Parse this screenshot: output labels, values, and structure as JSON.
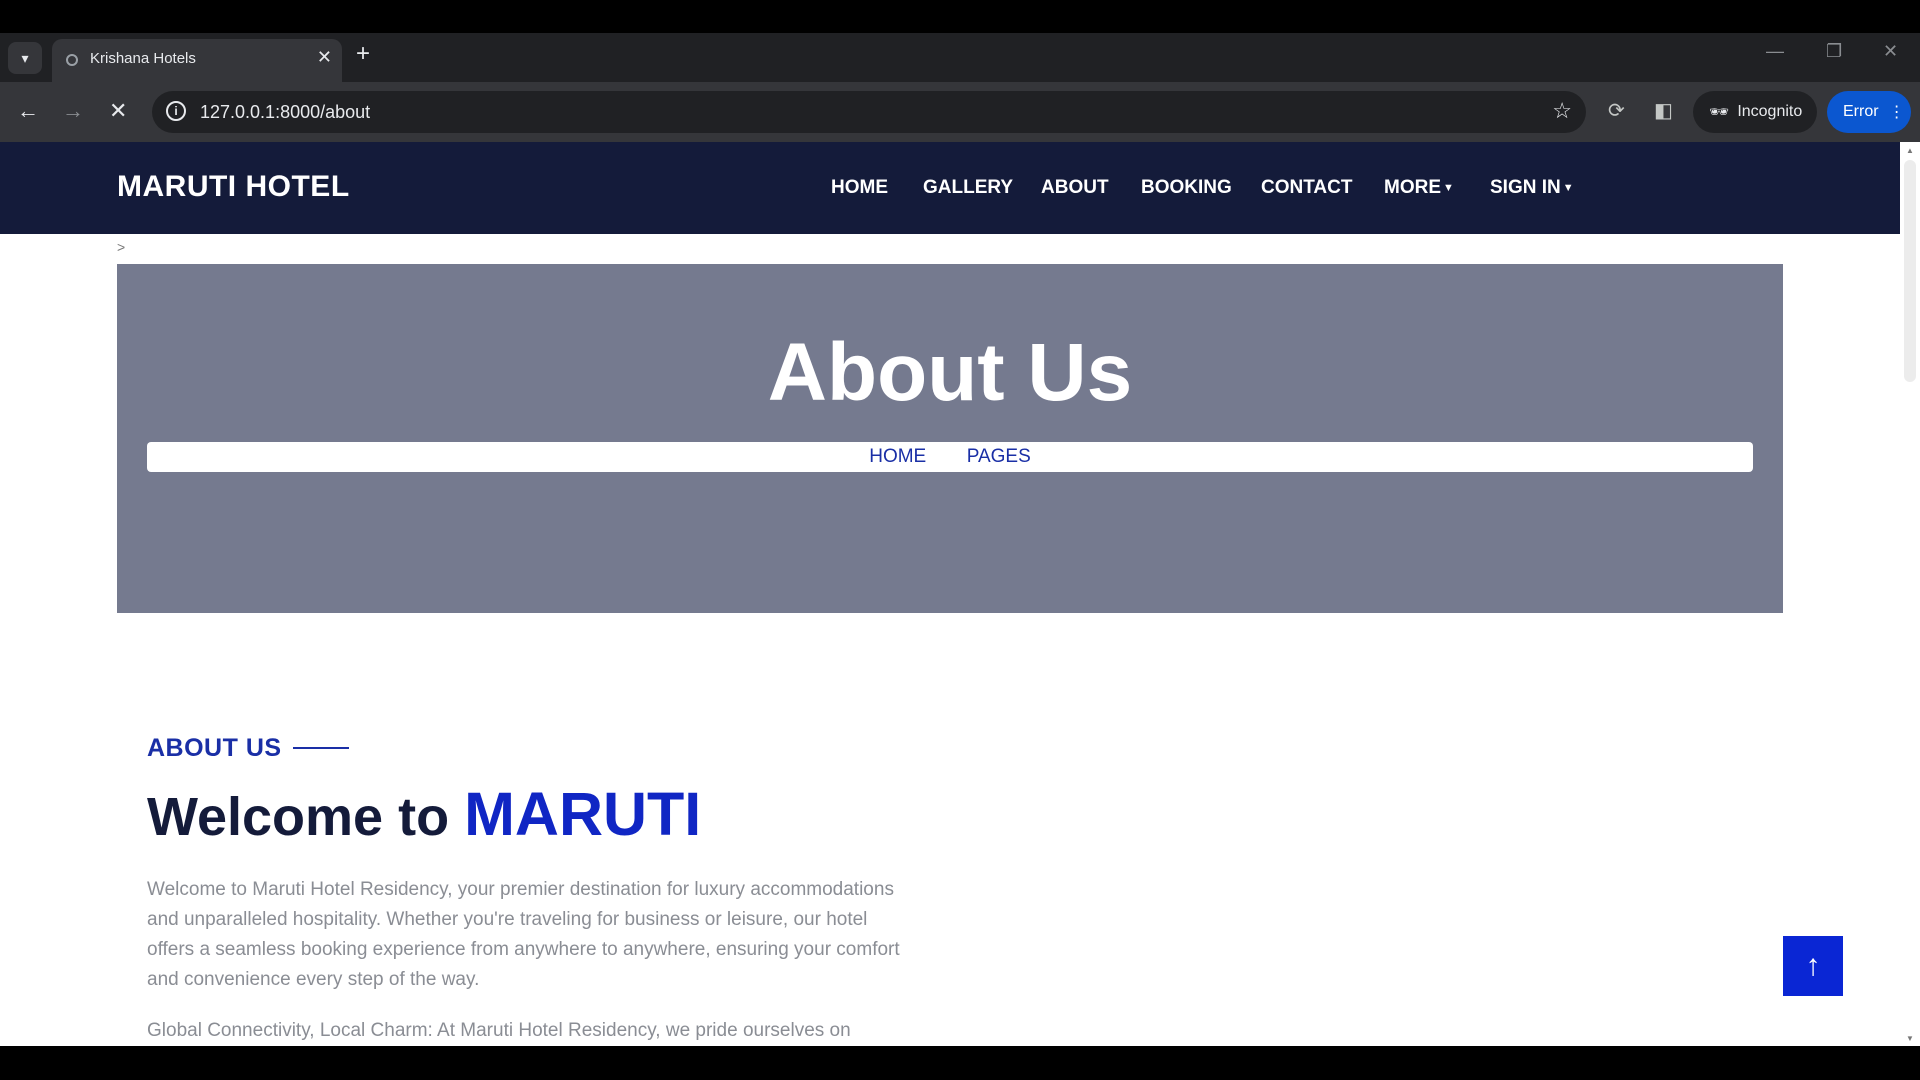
{
  "browser": {
    "tab_title": "Krishana Hotels",
    "url": "127.0.0.1:8000/about",
    "incognito_label": "Incognito",
    "error_label": "Error"
  },
  "site": {
    "brand": "MARUTI HOTEL",
    "nav": [
      "HOME",
      "GALLERY",
      "ABOUT",
      "BOOKING",
      "CONTACT",
      "MORE",
      "SIGN IN"
    ],
    "breadcrumb_separator": ">"
  },
  "hero": {
    "title": "About Us",
    "crumbs": [
      "HOME",
      "PAGES"
    ]
  },
  "about": {
    "label": "ABOUT US",
    "welcome": "Welcome to",
    "welcome_accent": "MARUTI",
    "para1": "Welcome to Maruti Hotel Residency, your premier destination for luxury accommodations and unparalleled hospitality. Whether you're traveling for business or leisure, our hotel offers a seamless booking experience from anywhere to anywhere, ensuring your comfort and convenience every step of the way.",
    "para2": "Global Connectivity, Local Charm: At Maruti Hotel Residency, we pride ourselves on"
  },
  "colors": {
    "nav_bg": "#141b3a",
    "hero_bg": "#757a8f",
    "accent": "#1026c4",
    "back_to_top": "#0a26d4"
  }
}
